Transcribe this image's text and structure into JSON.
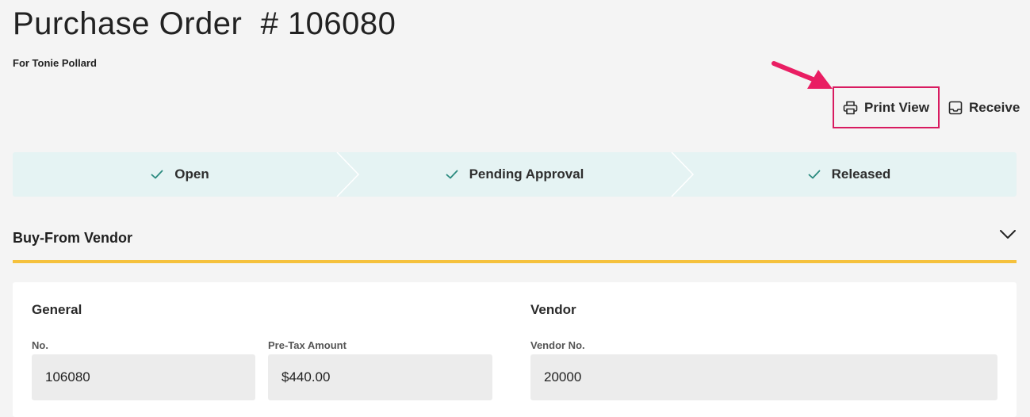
{
  "header": {
    "title": "Purchase Order  # 106080",
    "subtitle": "For Tonie Pollard"
  },
  "actions": [
    {
      "label": "Print View",
      "icon": "printer-icon"
    },
    {
      "label": "Receive",
      "icon": "inbox-icon"
    }
  ],
  "highlight_color": "#d81b60",
  "stepper": {
    "steps": [
      {
        "label": "Open",
        "status": "complete"
      },
      {
        "label": "Pending Approval",
        "status": "complete"
      },
      {
        "label": "Released",
        "status": "complete"
      }
    ],
    "background": "#e5f3f3",
    "check_color": "#2a8a7e"
  },
  "section": {
    "title": "Buy-From Vendor",
    "accent": "#f5c13d",
    "expanded": true
  },
  "general": {
    "title": "General",
    "fields": [
      {
        "label": "No.",
        "value": "106080"
      },
      {
        "label": "Pre-Tax Amount",
        "value": "$440.00"
      }
    ]
  },
  "vendor": {
    "title": "Vendor",
    "fields": [
      {
        "label": "Vendor No.",
        "value": "20000"
      }
    ]
  }
}
